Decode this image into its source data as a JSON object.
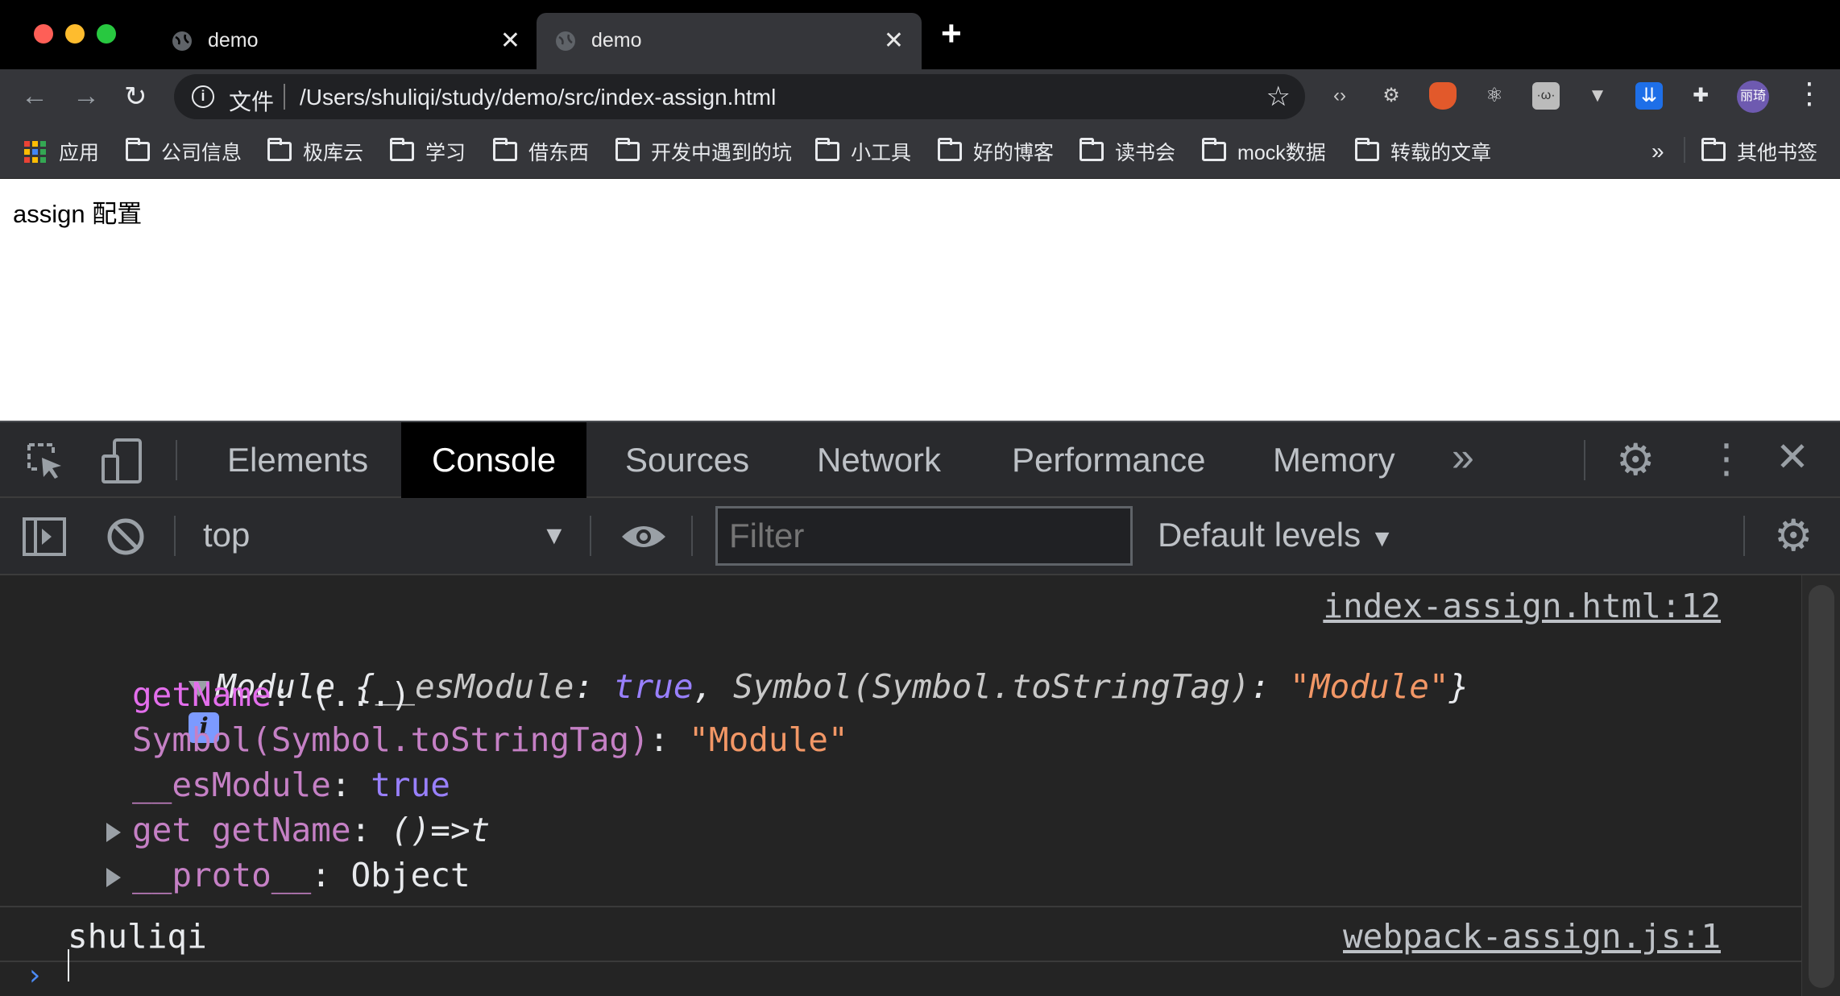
{
  "tabs": [
    {
      "title": "demo",
      "active": false
    },
    {
      "title": "demo",
      "active": true
    }
  ],
  "address_bar": {
    "scheme_label": "文件",
    "url": "/Users/shuliqi/study/demo/src/index-assign.html"
  },
  "profile": {
    "initials": "丽琦"
  },
  "bookmarks": {
    "apps_label": "应用",
    "items": [
      "公司信息",
      "极库云",
      "学习",
      "借东西",
      "开发中遇到的坑",
      "小工具",
      "好的博客",
      "读书会",
      "mock数据",
      "转载的文章"
    ],
    "overflow": "»",
    "other": "其他书签"
  },
  "page": {
    "text": "assign 配置"
  },
  "devtools": {
    "tabs": [
      "Elements",
      "Console",
      "Sources",
      "Network",
      "Performance",
      "Memory"
    ],
    "active_tab": "Console",
    "more": "»",
    "context": "top",
    "filter_placeholder": "Filter",
    "levels": "Default levels",
    "log1": {
      "source": "index-assign.html:12",
      "summary_head": "Module {",
      "summary_k1": "__esModule",
      "summary_v1": "true",
      "summary_k2": "Symbol(Symbol.toStringTag)",
      "summary_v2": "\"Module\"",
      "summary_tail": "}",
      "badge": "i",
      "props": [
        {
          "key": "getName",
          "value": "(...)"
        },
        {
          "key": "Symbol(Symbol.toStringTag)",
          "value": "\"Module\""
        },
        {
          "key": "__esModule",
          "value": "true"
        },
        {
          "key": "get getName",
          "value": "()=>t"
        },
        {
          "key": "__proto__",
          "value": "Object"
        }
      ]
    },
    "log2": {
      "text": "shuliqi",
      "source": "webpack-assign.js:1"
    }
  }
}
